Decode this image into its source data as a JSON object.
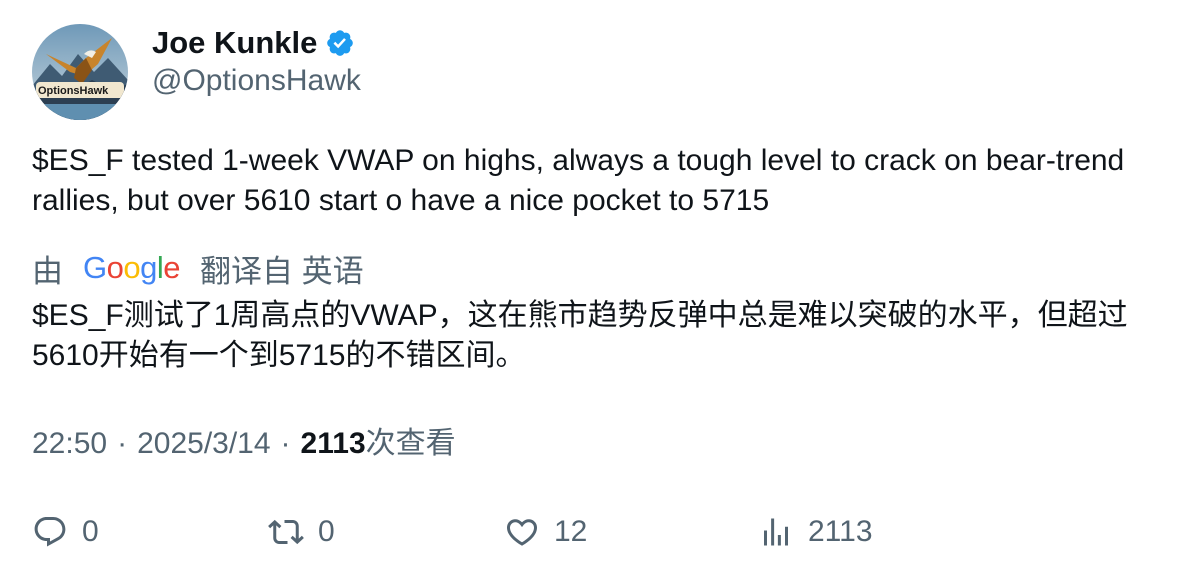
{
  "author": {
    "display_name": "Joe Kunkle",
    "handle": "@OptionsHawk",
    "avatar_text": "OptionsHawk",
    "verified": true
  },
  "tweet": {
    "text": "$ES_F tested 1-week VWAP on highs, always a tough level to crack on bear-trend rallies, but over 5610 start o have a nice pocket to 5715",
    "translated_text": "$ES_F测试了1周高点的VWAP，这在熊市趋势反弹中总是难以突破的水平，但超过5610开始有一个到5715的不错区间。"
  },
  "translation": {
    "prefix": "由",
    "provider": "Google",
    "suffix": "翻译自 英语"
  },
  "meta": {
    "time": "22:50",
    "separator": "·",
    "date": "2025/3/14",
    "views": "2113",
    "views_label": "次查看"
  },
  "actions": {
    "reply_count": "0",
    "retweet_count": "0",
    "like_count": "12",
    "views_count": "2113"
  },
  "colors": {
    "text_primary": "#0f1419",
    "text_secondary": "#536471",
    "verified_blue": "#1d9bf0"
  }
}
